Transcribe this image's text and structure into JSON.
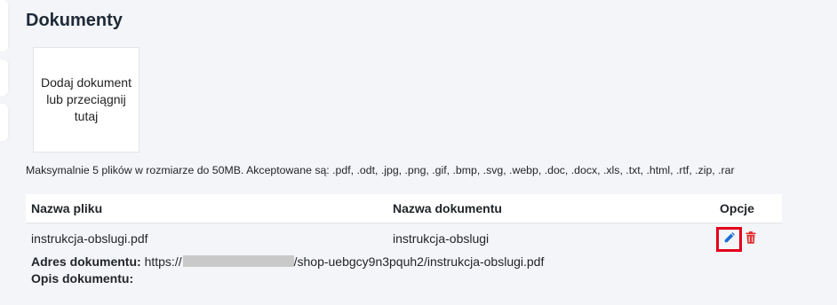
{
  "page": {
    "title": "Dokumenty"
  },
  "upload": {
    "dropzone_label": "Dodaj dokument lub przeciągnij tutaj",
    "limits_text": "Maksymalnie 5 plików w rozmiarze do 50MB. Akceptowane są: .pdf, .odt, .jpg, .png, .gif, .bmp, .svg, .webp, .doc, .docx, .xls, .txt, .html, .rtf, .zip, .rar"
  },
  "table": {
    "headers": {
      "file_name": "Nazwa pliku",
      "document_name": "Nazwa dokumentu",
      "options": "Opcje"
    },
    "rows": [
      {
        "file_name": "instrukcja-obslugi.pdf",
        "document_name": "instrukcja-obslugi",
        "address_label": "Adres dokumentu:",
        "address_prefix": "https://",
        "address_suffix": "/shop-uebgcy9n3pquh2/instrukcja-obslugi.pdf",
        "description_label": "Opis dokumentu:",
        "description_value": ""
      }
    ]
  },
  "icons": {
    "edit": "pencil-icon",
    "delete": "trash-icon"
  },
  "colors": {
    "edit_icon": "#1a6fd6",
    "delete_icon": "#e03131",
    "highlight_border": "#e3001b"
  }
}
